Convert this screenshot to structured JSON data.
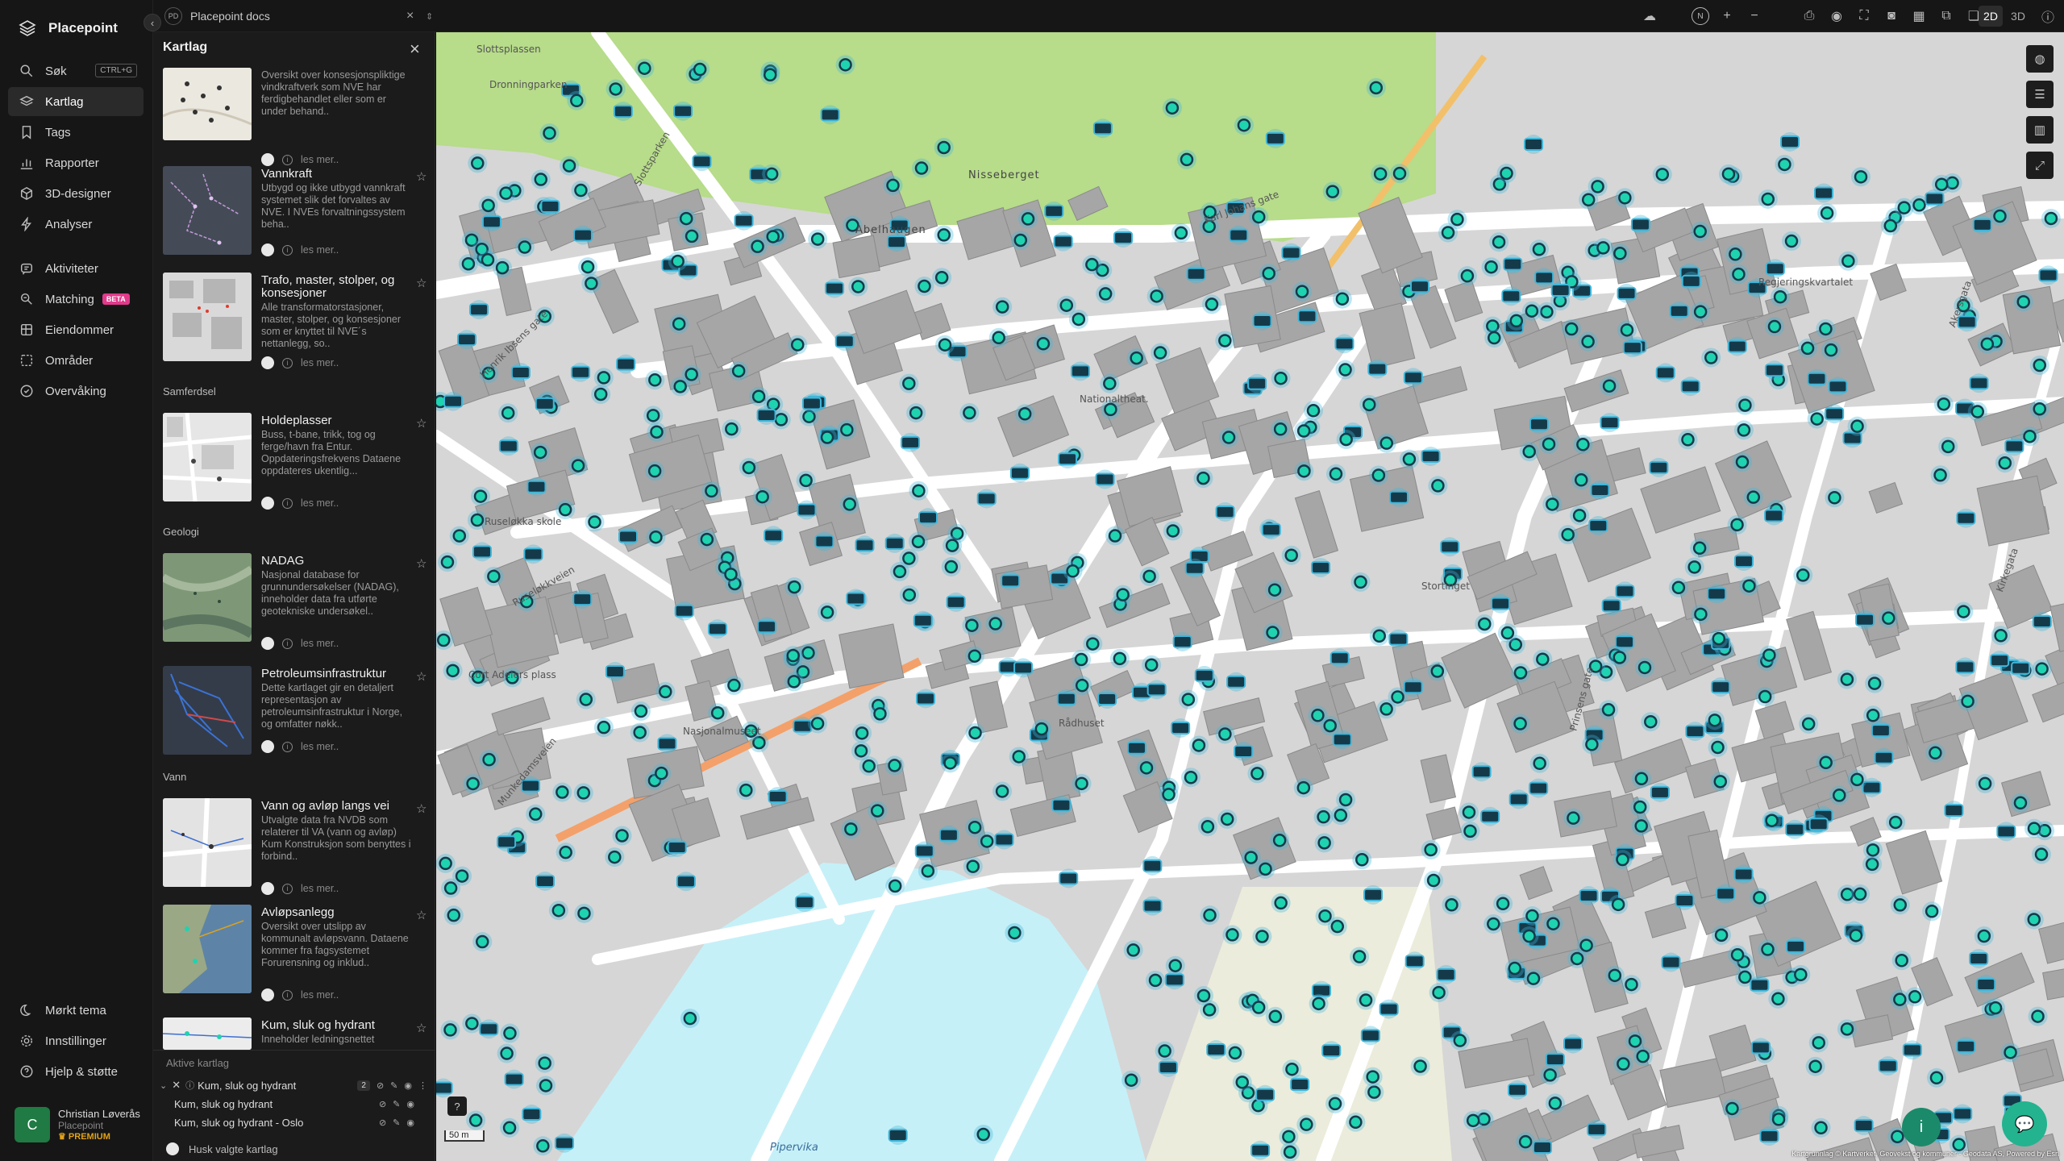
{
  "brand": "Placepoint",
  "nav": {
    "items": [
      {
        "label": "Søk",
        "icon": "search-icon",
        "shortcut": "CTRL+G"
      },
      {
        "label": "Kartlag",
        "icon": "layers-icon"
      },
      {
        "label": "Tags",
        "icon": "bookmark-icon"
      },
      {
        "label": "Rapporter",
        "icon": "chart-icon"
      },
      {
        "label": "3D-designer",
        "icon": "cube-icon"
      },
      {
        "label": "Analyser",
        "icon": "bolt-icon"
      },
      {
        "label": "Aktiviteter",
        "icon": "activity-icon"
      },
      {
        "label": "Matching",
        "icon": "match-icon",
        "badge": "BETA"
      },
      {
        "label": "Eiendommer",
        "icon": "property-icon"
      },
      {
        "label": "Områder",
        "icon": "area-icon"
      },
      {
        "label": "Overvåking",
        "icon": "monitor-icon"
      }
    ],
    "bottom": [
      {
        "label": "Mørkt tema",
        "icon": "moon-icon"
      },
      {
        "label": "Innstillinger",
        "icon": "gear-icon"
      },
      {
        "label": "Hjelp & støtte",
        "icon": "help-icon"
      }
    ],
    "user": {
      "initial": "C",
      "name": "Christian Løverås",
      "org": "Placepoint",
      "plan": "PREMIUM"
    }
  },
  "tab": {
    "badge": "PD",
    "title": "Placepoint docs"
  },
  "toolbar": {
    "north": "N",
    "mode_2d": "2D",
    "mode_3d": "3D"
  },
  "panel": {
    "title": "Kartlag",
    "more_label": "les mer..",
    "layers": [
      {
        "name": "",
        "desc": "Oversikt over konsesjonspliktige vindkraftverk som NVE har ferdigbehandlet eller som er under behand.."
      },
      {
        "name": "Vannkraft",
        "desc": "Utbygd og ikke utbygd vannkraft systemet slik det forvaltes av NVE. I NVEs forvaltningssystem beha.."
      },
      {
        "name": "Trafo, master, stolper, og konsesjoner",
        "desc": "Alle transformatorstasjoner, master, stolper, og konsesjoner som er knyttet til NVE´s nettanlegg, so.."
      },
      {
        "name": "Holdeplasser",
        "desc": "Buss, t-bane, trikk, tog og ferge/havn fra Entur. Oppdateringsfrekvens Dataene oppdateres ukentlig...",
        "section": "Samferdsel"
      },
      {
        "name": "NADAG",
        "desc": "Nasjonal database for grunnundersøkelser (NADAG), inneholder data fra utførte geotekniske undersøkel..",
        "section": "Geologi"
      },
      {
        "name": "Petroleumsinfrastruktur",
        "desc": "Dette kartlaget gir en detaljert representasjon av petroleumsinfrastruktur i Norge, og omfatter nøkk.."
      },
      {
        "name": "Vann og avløp langs vei",
        "desc": "Utvalgte data fra NVDB som relaterer til VA (vann og avløp) Kum Konstruksjon som benyttes i forbind..",
        "section": "Vann"
      },
      {
        "name": "Avløpsanlegg",
        "desc": "Oversikt over utslipp av kommunalt avløpsvann. Dataene kommer fra fagsystemet Forurensning og inklud.."
      },
      {
        "name": "Kum, sluk og hydrant",
        "desc": "Inneholder ledningsnettet"
      }
    ],
    "active": {
      "header": "Aktive kartlag",
      "group": "Kum, sluk og hydrant",
      "count": "2",
      "children": [
        "Kum, sluk og hydrant",
        "Kum, sluk og hydrant - Oslo"
      ],
      "remember": "Husk valgte kartlag"
    }
  },
  "map": {
    "labels": [
      "Slottsplassen",
      "Dronningparken",
      "Slottsparken",
      "Abelhaugen",
      "Nisseberget",
      "Regjeringskvartalet",
      "Nationaltheat.",
      "Ruseløkka skole",
      "Nasjonalmuseet",
      "Rådhuset",
      "Stortinget",
      "Pipervika",
      "Cort Adelers plass",
      "Ruseløkkveien",
      "Henrik Ibsens gate",
      "Munkedamsveien",
      "Karl Johans gate",
      "Akersgata",
      "Prinsens gate",
      "Kirkegata"
    ],
    "scale": "50 m",
    "attribution": "Kartgrunnlag © Kartverket, Geovekst og kommuner - Geodata AS, Powered by Esri",
    "colors": {
      "marker": "#1fd3b0",
      "marker_dark": "#143a4a",
      "marker_glow": "#3fb6d9",
      "park": "#b7dc8a",
      "water": "#c6f0f8",
      "building": "#a6a6a6"
    }
  }
}
